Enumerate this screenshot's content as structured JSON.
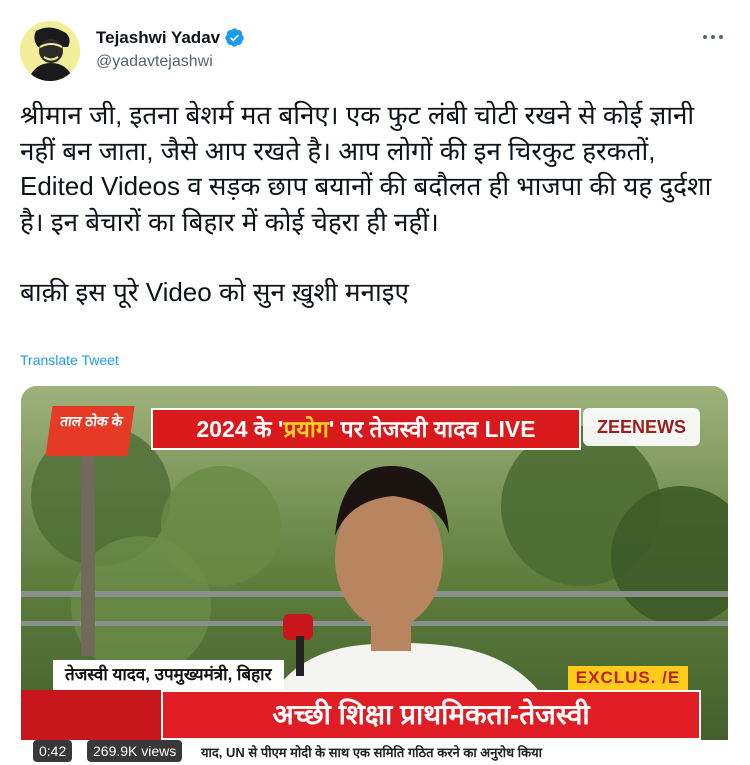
{
  "author": {
    "display_name": "Tejashwi Yadav",
    "handle": "@yadavtejashwi",
    "verified": true,
    "avatar_icon": "profile-avatar"
  },
  "menu_icon": "more-dots-icon",
  "tweet": {
    "text_line1": "श्रीमान जी, इतना बेशर्म मत बनिए। एक फुट लंबी चोटी रखने से कोई ज्ञानी नहीं बन जाता, जैसे आप रखते है। आप लोगों की इन चिरकुट हरकतों, Edited Videos व सड़क छाप बयानों की बदौलत ही भाजपा की यह दुर्दशा है। इन बेचारों का बिहार में कोई चेहरा ही नहीं।",
    "text_line2": "बाक़ी इस पूरे Video को सुन ख़ुशी मनाइए",
    "translate_label": "Translate Tweet"
  },
  "video": {
    "show_logo": "ताल ठोक के",
    "top_banner_pre": "2024 के '",
    "top_banner_highlight": "प्रयोग",
    "top_banner_post": "' पर तेजस्वी यादव LIVE",
    "channel": "ZEENEWS",
    "lower_third": "तेजस्वी यादव, उपमुख्यमंत्री, बिहार",
    "exclusive": "EXCLUS. /E",
    "headline": "अच्छी शिक्षा प्राथमिकता-तेजस्वी",
    "ticker": "याद, UN से पीएम मोदी के साथ एक समिति गठित करने का अनुरोध किया",
    "duration": "0:42",
    "views": "269.9K views"
  },
  "colors": {
    "link_blue": "#1d9bf0",
    "verified_blue": "#1d9bf0",
    "banner_red": "#d9191c",
    "muted_text": "#536471"
  }
}
